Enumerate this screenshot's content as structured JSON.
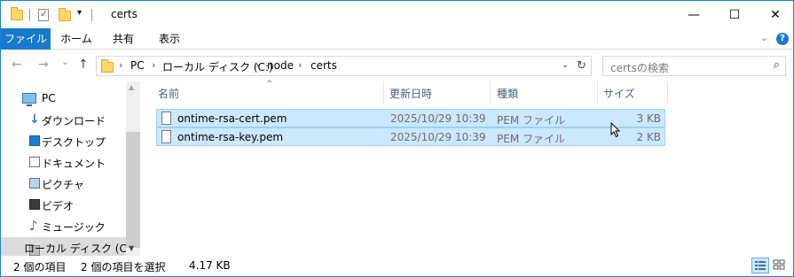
{
  "window": {
    "title": "certs",
    "accent": "#1979ca",
    "controls": {
      "minimize": "—",
      "maximize": "☐",
      "close": "✕"
    }
  },
  "ribbon": {
    "tabs": [
      {
        "label": "ファイル",
        "active": true
      },
      {
        "label": "ホーム"
      },
      {
        "label": "共有"
      },
      {
        "label": "表示"
      }
    ],
    "expand_icon": "chevron-down-icon",
    "help_label": "?"
  },
  "address": {
    "back": "←",
    "forward": "→",
    "recent": "⌄",
    "up": "↑",
    "crumbs": [
      "PC",
      "ローカル ディスク (C:)",
      "node",
      "certs"
    ],
    "crumb_sep": "›",
    "refresh": "↻",
    "search_placeholder": "certsの検索",
    "search_icon": "⌕"
  },
  "nav": {
    "items": [
      {
        "label": "PC",
        "icon": "pc-icon"
      },
      {
        "label": "ダウンロード",
        "icon": "download-icon"
      },
      {
        "label": "デスクトップ",
        "icon": "desktop-icon"
      },
      {
        "label": "ドキュメント",
        "icon": "document-icon"
      },
      {
        "label": "ピクチャ",
        "icon": "pictures-icon"
      },
      {
        "label": "ビデオ",
        "icon": "video-icon"
      },
      {
        "label": "ミュージック",
        "icon": "music-icon"
      },
      {
        "label": "ローカル ディスク (C",
        "icon": "drive-icon",
        "selected": true
      }
    ]
  },
  "columns": {
    "name": "名前",
    "modified": "更新日時",
    "type": "種類",
    "size": "サイズ"
  },
  "files": [
    {
      "name": "ontime-rsa-cert.pem",
      "modified": "2025/10/29 10:39",
      "type": "PEM ファイル",
      "size": "3 KB",
      "selected": true
    },
    {
      "name": "ontime-rsa-key.pem",
      "modified": "2025/10/29 10:39",
      "type": "PEM ファイル",
      "size": "2 KB",
      "selected": true
    }
  ],
  "status": {
    "item_count": "2 個の項目",
    "selection": "2 個の項目を選択",
    "selection_size": "4.17 KB"
  },
  "colors": {
    "selection_bg": "#cce8ff",
    "selection_border": "#99d1ff",
    "header_text": "#4c607a"
  }
}
